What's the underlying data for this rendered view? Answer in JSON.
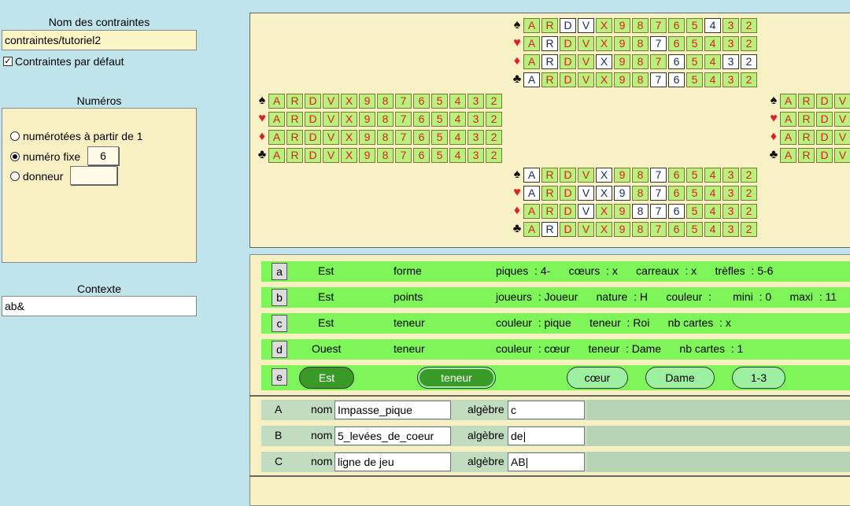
{
  "left": {
    "constraints_title": "Nom des contraintes",
    "constraints_value": "contraintes/tutoriel2",
    "default_checkbox_label": "Contraintes par défaut",
    "default_checked": true,
    "numbers_title": "Numéros",
    "radio_numbered": "numérotées à partir de 1",
    "radio_fixed": "numéro fixe",
    "fixed_value": "6",
    "radio_dealer": "donneur",
    "dealer_value": "",
    "context_title": "Contexte",
    "context_value": "ab&"
  },
  "board": {
    "ranks": [
      "A",
      "R",
      "D",
      "V",
      "X",
      "9",
      "8",
      "7",
      "6",
      "5",
      "4",
      "3",
      "2"
    ],
    "suits": [
      {
        "name": "spade",
        "symbol": "♠",
        "color": "#111111"
      },
      {
        "name": "heart",
        "symbol": "♥",
        "color": "#e02020"
      },
      {
        "name": "diamond",
        "symbol": "♦",
        "color": "#e02020"
      },
      {
        "name": "club",
        "symbol": "♣",
        "color": "#111111"
      }
    ],
    "north": [
      [
        0,
        0,
        1,
        1,
        0,
        0,
        0,
        0,
        0,
        0,
        1,
        0,
        0
      ],
      [
        0,
        1,
        0,
        0,
        0,
        0,
        0,
        1,
        0,
        0,
        0,
        0,
        0
      ],
      [
        0,
        1,
        0,
        0,
        1,
        0,
        0,
        0,
        1,
        0,
        0,
        1,
        1
      ],
      [
        1,
        0,
        0,
        0,
        0,
        0,
        0,
        1,
        1,
        0,
        0,
        0,
        0
      ]
    ],
    "west": [
      [
        0,
        0,
        0,
        0,
        0,
        0,
        0,
        0,
        0,
        0,
        0,
        0,
        0
      ],
      [
        0,
        0,
        0,
        0,
        0,
        0,
        0,
        0,
        0,
        0,
        0,
        0,
        0
      ],
      [
        0,
        0,
        0,
        0,
        0,
        0,
        0,
        0,
        0,
        0,
        0,
        0,
        0
      ],
      [
        0,
        0,
        0,
        0,
        0,
        0,
        0,
        0,
        0,
        0,
        0,
        0,
        0
      ]
    ],
    "east": [
      [
        0,
        0,
        0,
        0
      ],
      [
        0,
        0,
        0,
        0
      ],
      [
        0,
        0,
        0,
        0
      ],
      [
        0,
        0,
        0,
        0
      ]
    ],
    "south": [
      [
        1,
        0,
        0,
        0,
        1,
        0,
        0,
        1,
        0,
        0,
        0,
        0,
        0
      ],
      [
        1,
        0,
        0,
        1,
        1,
        1,
        0,
        1,
        0,
        0,
        0,
        0,
        0
      ],
      [
        0,
        0,
        0,
        1,
        0,
        0,
        1,
        1,
        1,
        0,
        0,
        0,
        0
      ],
      [
        0,
        1,
        0,
        0,
        0,
        0,
        0,
        0,
        0,
        0,
        0,
        0,
        0
      ]
    ]
  },
  "constraints": [
    {
      "letter": "a",
      "player": "Est",
      "type": "forme",
      "detail": "piques  : 4-      cœurs  : x      carreaux  : x      trèfles  : 5-6"
    },
    {
      "letter": "b",
      "player": "Est",
      "type": "points",
      "detail": "joueurs  : Joueur      nature  : H      couleur  :       mini  : 0      maxi  : 11"
    },
    {
      "letter": "c",
      "player": "Est",
      "type": "teneur",
      "detail": "couleur  : pique      teneur  : Roi      nb cartes  : x"
    },
    {
      "letter": "d",
      "player": "Ouest",
      "type": "teneur",
      "detail": "couleur  : cœur      teneur  : Dame      nb cartes  : 1"
    }
  ],
  "edit_row": {
    "letter": "e",
    "player": "Est",
    "type": "teneur",
    "suit": "cœur",
    "rank": "Dame",
    "count": "1-3"
  },
  "names_label": "nom",
  "algebra_label": "algèbre",
  "names": [
    {
      "id": "A",
      "name": "Impasse_pique",
      "algebra": "c"
    },
    {
      "id": "B",
      "name": "5_levées_de_coeur",
      "algebra": "de|"
    },
    {
      "id": "C",
      "name": "ligne de jeu",
      "algebra": "AB|"
    }
  ]
}
